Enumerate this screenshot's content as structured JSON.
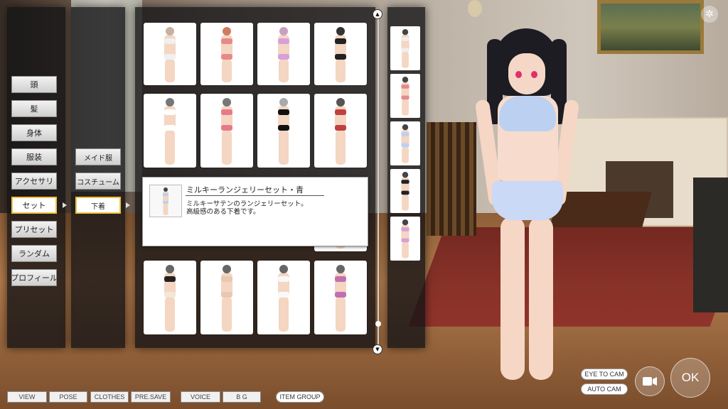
{
  "categories": [
    {
      "label": "頭",
      "selected": false
    },
    {
      "label": "髪",
      "selected": false
    },
    {
      "label": "身体",
      "selected": false
    },
    {
      "label": "服装",
      "selected": false
    },
    {
      "label": "アクセサリ",
      "selected": false
    },
    {
      "label": "セット",
      "selected": true
    },
    {
      "label": "プリセット",
      "selected": false
    },
    {
      "label": "ランダム",
      "selected": false
    },
    {
      "label": "プロフィール",
      "selected": false
    }
  ],
  "subcategories": [
    {
      "label": "メイド服",
      "selected": false
    },
    {
      "label": "コスチューム",
      "selected": false
    },
    {
      "label": "下着",
      "selected": true
    }
  ],
  "tooltip": {
    "title": "ミルキーランジェリーセット・青",
    "description_line1": "ミルキーサテンのランジェリーセット。",
    "description_line2": "高級感のある下着です。"
  },
  "items": [
    {
      "hair": "#c8b0a0",
      "top": "#f0f0f0",
      "bottom": "#f0f0f0"
    },
    {
      "hair": "#d07a60",
      "top": "#e58a8a",
      "bottom": "#e58a8a"
    },
    {
      "hair": "#c8a0c0",
      "top": "#d8a0d8",
      "bottom": "#d8a0d8"
    },
    {
      "hair": "#333333",
      "top": "#222222",
      "bottom": "#222222"
    },
    {
      "hair": "#777777",
      "top": "#ffffff",
      "bottom": "#ffffff"
    },
    {
      "hair": "#777777",
      "top": "#e77a8a",
      "bottom": "#e77a8a"
    },
    {
      "hair": "#aaaaaa",
      "top": "#111111",
      "bottom": "#111111"
    },
    {
      "hair": "#555555",
      "top": "#c04040",
      "bottom": "#c04040"
    },
    {
      "hair": "#555555",
      "top": "#c06060",
      "bottom": "#c06060"
    },
    {
      "hair": "#666666",
      "top": "#222222",
      "bottom": "#f0e8d8"
    },
    {
      "hair": "#666666",
      "top": "#e8c8b0",
      "bottom": "#e8c8b0"
    },
    {
      "hair": "#666666",
      "top": "#f8f8f8",
      "bottom": "#f8f8f8"
    },
    {
      "hair": "#666666",
      "top": "#c070b0",
      "bottom": "#c070b0"
    }
  ],
  "thumbnails": [
    {
      "top": "#eeeeee",
      "bottom": "#eeeeee"
    },
    {
      "top": "#e58a8a",
      "bottom": "#e58a8a"
    },
    {
      "top": "#bcd0f2",
      "bottom": "#bcd0f2"
    },
    {
      "top": "#222222",
      "bottom": "#222222"
    },
    {
      "top": "#d8a0d8",
      "bottom": "#d8a0d8"
    }
  ],
  "bottom_bar": {
    "view": "VIEW",
    "pose": "POSE",
    "clothes": "CLOTHES",
    "pre_save": "PRE.SAVE",
    "voice": "VOICE",
    "bg": "B G",
    "item_group": "ITEM GROUP"
  },
  "camera": {
    "eye_to_cam": "EYE TO CAM",
    "auto_cam": "AUTO CAM",
    "ok": "OK"
  },
  "icons": {
    "settings": "gear-icon",
    "camera": "video-camera-icon",
    "scroll_up": "scroll-up-icon",
    "scroll_down": "scroll-down-icon"
  }
}
